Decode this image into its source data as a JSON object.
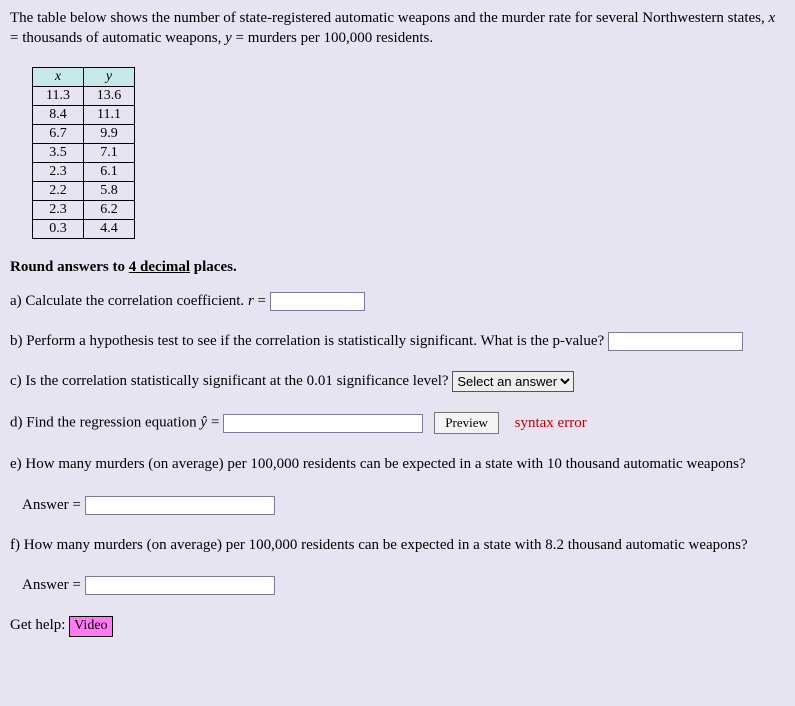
{
  "intro": {
    "text_before_x": "The table below shows the number of state-registered automatic weapons and the murder rate for several Northwestern states, ",
    "x": "x",
    "text_mid": " = thousands of automatic weapons, ",
    "y": "y",
    "text_after_y": " = murders per 100,000 residents."
  },
  "table": {
    "col_x": "x",
    "col_y": "y",
    "rows": [
      {
        "x": "11.3",
        "y": "13.6"
      },
      {
        "x": "8.4",
        "y": "11.1"
      },
      {
        "x": "6.7",
        "y": "9.9"
      },
      {
        "x": "3.5",
        "y": "7.1"
      },
      {
        "x": "2.3",
        "y": "6.1"
      },
      {
        "x": "2.2",
        "y": "5.8"
      },
      {
        "x": "2.3",
        "y": "6.2"
      },
      {
        "x": "0.3",
        "y": "4.4"
      }
    ]
  },
  "round_note": {
    "pre": "Round answers to ",
    "u": "4 decimal",
    "post": " places."
  },
  "qa": {
    "a_text": "a) Calculate the correlation coefficient. ",
    "a_r": "r",
    "a_eq": " = ",
    "b_text": "b) Perform a hypothesis test to see if the correlation is statistically significant. What is the p-value? ",
    "c_text": "c) Is the correlation statistically significant at the 0.01 significance level? ",
    "c_select_placeholder": "Select an answer",
    "d_text": "d) Find the regression equation ",
    "d_yhat": "ŷ",
    "d_eq": " = ",
    "d_preview": "Preview",
    "d_syntax": "syntax error",
    "e_text": "e) How many murders (on average) per 100,000 residents can be expected in a state with 10 thousand automatic weapons?",
    "f_text": "f) How many murders (on average) per 100,000 residents can be expected in a state with 8.2 thousand automatic weapons?",
    "answer_label": "Answer = "
  },
  "help": {
    "label": "Get help: ",
    "video": "Video"
  }
}
